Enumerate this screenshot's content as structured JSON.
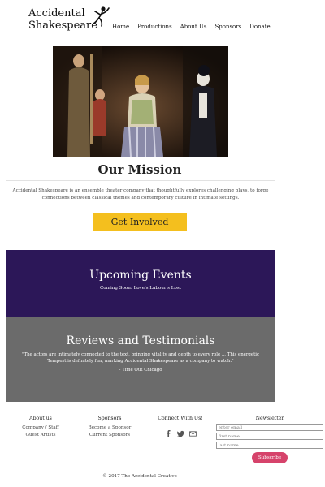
{
  "brand": {
    "line1": "Accidental",
    "line2": "Shakespeare"
  },
  "nav": {
    "items": [
      "Home",
      "Productions",
      "About Us",
      "Sponsors",
      "Donate"
    ]
  },
  "mission": {
    "title": "Our Mission",
    "text": "Accidental Shakespeare is an ensemble theater company that thoughtfully explores challenging plays, to forge connections between classical themes and contemporary culture in intimate settings.",
    "cta_label": "Get Involved"
  },
  "events": {
    "title": "Upcoming Events",
    "subtitle": "Coming Soon: Love's Labour's Lost"
  },
  "reviews": {
    "title": "Reviews and Testimonials",
    "quote": "\"The actors are intimately connected to the text, bringing vitality and depth to every role ... This energetic Tempest is definitely fun, marking Accidental Shakespeare as a company to watch.\"",
    "source": "- Time Out Chicago"
  },
  "footer": {
    "about": {
      "title": "About us",
      "links": [
        "Company / Staff",
        "Guest Artists"
      ]
    },
    "sponsors": {
      "title": "Sponsors",
      "links": [
        "Become a Sponsor",
        "Current Sponsors"
      ]
    },
    "connect": {
      "title": "Connect With Us!",
      "icons": [
        "facebook-icon",
        "twitter-icon",
        "email-icon"
      ]
    },
    "newsletter": {
      "title": "Newsletter",
      "email_placeholder": "enter email",
      "first_placeholder": "first name",
      "last_placeholder": "last name",
      "subscribe_label": "Subscribe"
    },
    "copyright": "© 2017 The Accidental Creative"
  },
  "colors": {
    "cta": "#f4bf1e",
    "events_bg": "#2c1758",
    "reviews_bg": "#6b6b6b",
    "subscribe": "#d6436b"
  }
}
